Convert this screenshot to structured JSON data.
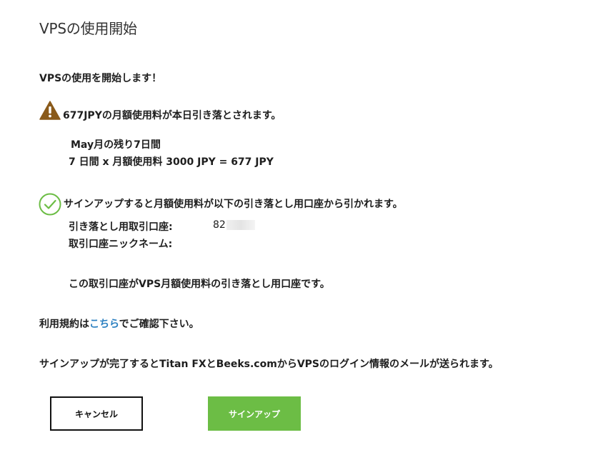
{
  "page": {
    "title": "VPSの使用開始"
  },
  "intro": {
    "text": "VPSの使用を開始します！"
  },
  "warning": {
    "text": "677JPYの月額使用料が本日引き落とされます。",
    "icon": "warning-triangle-icon",
    "color": "#8a5a1a"
  },
  "calculation": {
    "remaining": "May月の残り7日間",
    "formula": "7 日間 x 月額使用料 3000 JPY = 677 JPY"
  },
  "account": {
    "icon": "check-circle-icon",
    "icon_color": "#6cbd45",
    "heading": "サインアップすると月額使用料が以下の引き落とし用口座から引かれます。",
    "debit_label": "引き落とし用取引口座:",
    "debit_value_visible": "82",
    "nickname_label": "取引口座ニックネーム:",
    "note": "この取引口座がVPS月額使用料の引き落とし用口座です。"
  },
  "terms": {
    "prefix": "利用規約は",
    "link": "こちら",
    "suffix": "でご確認下さい。",
    "link_color": "#2a7fc0"
  },
  "info": {
    "text": "サインアップが完了するとTitan FXとBeeks.comからVPSのログイン情報のメールが送られます。"
  },
  "buttons": {
    "cancel": "キャンセル",
    "signup": "サインアップ",
    "signup_color": "#6cbd45"
  }
}
